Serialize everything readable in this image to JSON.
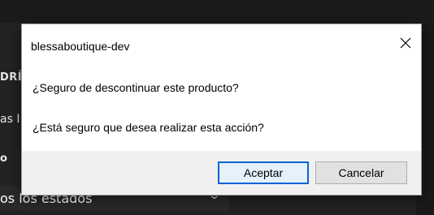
{
  "background": {
    "side_labels": [
      "DRÍ",
      "as I",
      "o"
    ],
    "filter_label": "os los estados"
  },
  "dialog": {
    "title": "blessaboutique-dev",
    "question": "¿Seguro de descontinuar este producto?",
    "confirm_text": "¿Está seguro que desea realizar esta acción?",
    "accept_label": "Aceptar",
    "cancel_label": "Cancelar"
  },
  "icons": {
    "close": "close-icon",
    "dropdown": "chevron-down-icon"
  },
  "colors": {
    "accent": "#0a64d8",
    "page_bg": "#1f1f1f"
  }
}
